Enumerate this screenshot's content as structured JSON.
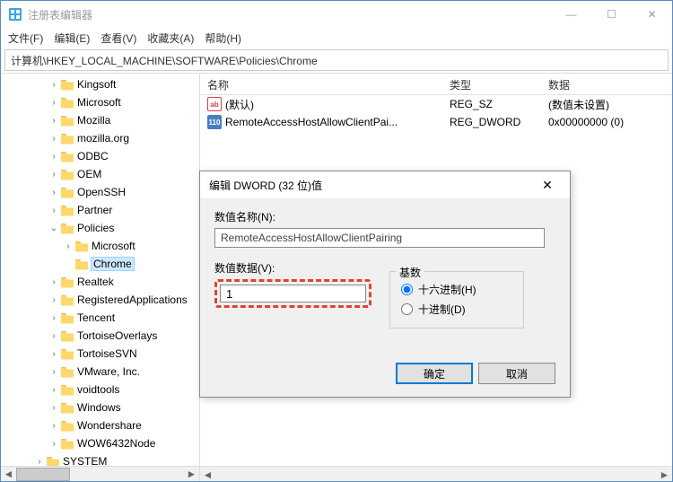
{
  "window": {
    "title": "注册表编辑器",
    "controls": {
      "min": "—",
      "max": "☐",
      "close": "✕"
    }
  },
  "menu": {
    "file": "文件(F)",
    "edit": "编辑(E)",
    "view": "查看(V)",
    "fav": "收藏夹(A)",
    "help": "帮助(H)"
  },
  "address": "计算机\\HKEY_LOCAL_MACHINE\\SOFTWARE\\Policies\\Chrome",
  "tree": [
    {
      "depth": 3,
      "exp": ">",
      "label": "Kingsoft"
    },
    {
      "depth": 3,
      "exp": ">",
      "label": "Microsoft"
    },
    {
      "depth": 3,
      "exp": ">",
      "label": "Mozilla"
    },
    {
      "depth": 3,
      "exp": ">",
      "label": "mozilla.org"
    },
    {
      "depth": 3,
      "exp": ">",
      "label": "ODBC"
    },
    {
      "depth": 3,
      "exp": ">",
      "label": "OEM"
    },
    {
      "depth": 3,
      "exp": ">",
      "label": "OpenSSH"
    },
    {
      "depth": 3,
      "exp": ">",
      "label": "Partner"
    },
    {
      "depth": 3,
      "exp": "v",
      "label": "Policies"
    },
    {
      "depth": 4,
      "exp": ">",
      "label": "Microsoft"
    },
    {
      "depth": 4,
      "exp": "",
      "label": "Chrome",
      "selected": true
    },
    {
      "depth": 3,
      "exp": ">",
      "label": "Realtek"
    },
    {
      "depth": 3,
      "exp": ">",
      "label": "RegisteredApplications"
    },
    {
      "depth": 3,
      "exp": ">",
      "label": "Tencent"
    },
    {
      "depth": 3,
      "exp": ">",
      "label": "TortoiseOverlays"
    },
    {
      "depth": 3,
      "exp": ">",
      "label": "TortoiseSVN"
    },
    {
      "depth": 3,
      "exp": ">",
      "label": "VMware, Inc."
    },
    {
      "depth": 3,
      "exp": ">",
      "label": "voidtools"
    },
    {
      "depth": 3,
      "exp": ">",
      "label": "Windows"
    },
    {
      "depth": 3,
      "exp": ">",
      "label": "Wondershare"
    },
    {
      "depth": 3,
      "exp": ">",
      "label": "WOW6432Node"
    },
    {
      "depth": 2,
      "exp": ">",
      "label": "SYSTEM"
    }
  ],
  "list": {
    "headers": {
      "name": "名称",
      "type": "类型",
      "data": "数据"
    },
    "rows": [
      {
        "icon": "ab",
        "name": "(默认)",
        "type": "REG_SZ",
        "data": "(数值未设置)"
      },
      {
        "icon": "bin",
        "name": "RemoteAccessHostAllowClientPai...",
        "type": "REG_DWORD",
        "data": "0x00000000 (0)"
      }
    ]
  },
  "dialog": {
    "title": "编辑 DWORD (32 位)值",
    "name_label": "数值名称(N):",
    "name_value": "RemoteAccessHostAllowClientPairing",
    "value_label": "数值数据(V):",
    "value": "1",
    "base_label": "基数",
    "hex": "十六进制(H)",
    "dec": "十进制(D)",
    "ok": "确定",
    "cancel": "取消",
    "close": "✕"
  }
}
